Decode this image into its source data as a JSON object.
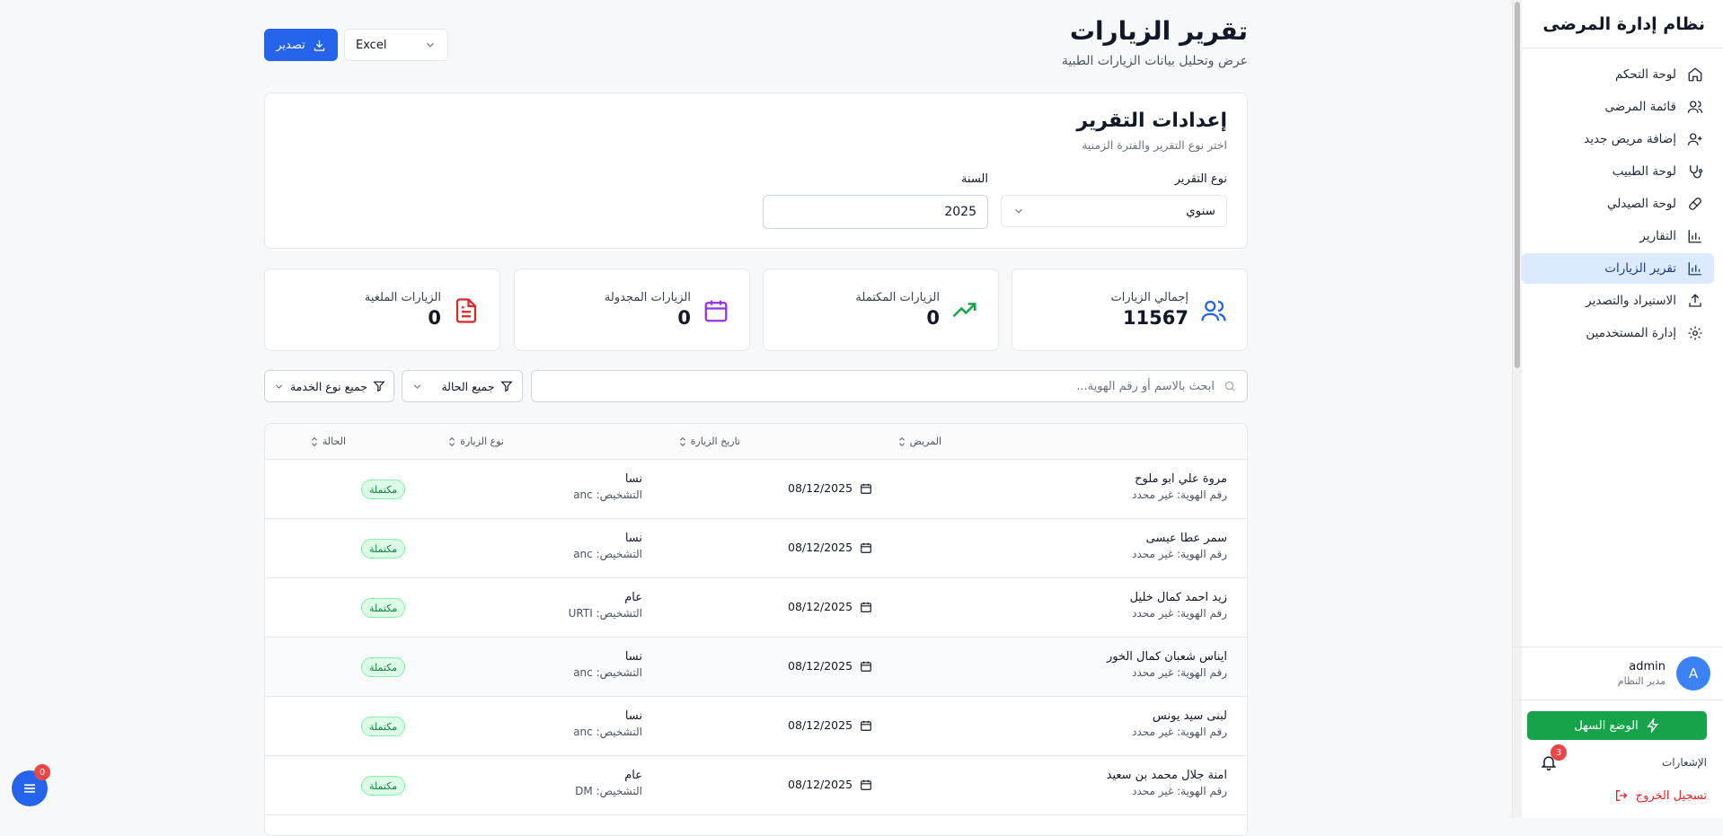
{
  "sidebar": {
    "title": "نظام إدارة المرضى",
    "items": [
      {
        "label": "لوحة التحكم",
        "icon": "home-icon"
      },
      {
        "label": "قائمة المرضى",
        "icon": "users-icon"
      },
      {
        "label": "إضافة مريض جديد",
        "icon": "user-plus-icon"
      },
      {
        "label": "لوحة الطبيب",
        "icon": "stethoscope-icon"
      },
      {
        "label": "لوحة الصيدلي",
        "icon": "pill-icon"
      },
      {
        "label": "التقارير",
        "icon": "bar-chart-icon"
      },
      {
        "label": "تقرير الزيارات",
        "icon": "bar-chart-icon",
        "active": true
      },
      {
        "label": "الاستيراد والتصدير",
        "icon": "upload-icon"
      },
      {
        "label": "إدارة المستخدمين",
        "icon": "gear-icon"
      }
    ],
    "user": {
      "initial": "A",
      "name": "admin",
      "role": "مدير النظام"
    },
    "easy_mode": "الوضع السهل",
    "notifications_label": "الإشعارات",
    "notifications_count": "3",
    "logout": "تسجيل الخروج"
  },
  "header": {
    "title": "تقرير الزيارات",
    "subtitle": "عرض وتحليل بيانات الزيارات الطبية",
    "export_label": "تصدير",
    "format_value": "Excel"
  },
  "settings": {
    "title": "إعدادات التقرير",
    "subtitle": "اختر نوع التقرير والفترة الزمنية",
    "type_label": "نوع التقرير",
    "type_value": "سنوي",
    "year_label": "السنة",
    "year_value": "2025"
  },
  "stats": [
    {
      "label": "إجمالي الزيارات",
      "value": "11567",
      "icon": "users-icon",
      "color": "#2563eb"
    },
    {
      "label": "الزيارات المكتملة",
      "value": "0",
      "icon": "trending-up-icon",
      "color": "#16a34a"
    },
    {
      "label": "الزيارات المجدولة",
      "value": "0",
      "icon": "calendar-icon",
      "color": "#9333ea"
    },
    {
      "label": "الزيارات الملغية",
      "value": "0",
      "icon": "file-text-icon",
      "color": "#dc2626"
    }
  ],
  "filters": {
    "search_placeholder": "ابحث بالاسم أو رقم الهوية...",
    "status_filter": "جميع الحالة",
    "service_filter": "جميع نوع الخدمة"
  },
  "table": {
    "columns": {
      "patient": "المريض",
      "date": "تاريخ الزيارة",
      "type": "نوع الزيارة",
      "status": "الحالة"
    },
    "rows": [
      {
        "name": "مروة علي ابو ملوح",
        "id_text": "رقم الهوية: غير محدد",
        "date": "08/12/2025",
        "type": "نسا",
        "diagnosis": "التشخيص: anc",
        "status": "مكتملة"
      },
      {
        "name": "سمر عطا عيسى",
        "id_text": "رقم الهوية: غير محدد",
        "date": "08/12/2025",
        "type": "نسا",
        "diagnosis": "التشخيص: anc",
        "status": "مكتملة"
      },
      {
        "name": "زيد احمد كمال خليل",
        "id_text": "رقم الهوية: غير محدد",
        "date": "08/12/2025",
        "type": "عام",
        "diagnosis": "التشخيص: URTI",
        "status": "مكتملة"
      },
      {
        "name": "ايناس شعبان كمال الخور",
        "id_text": "رقم الهوية: غير محدد",
        "date": "08/12/2025",
        "type": "نسا",
        "diagnosis": "التشخيص: anc",
        "status": "مكتملة"
      },
      {
        "name": "لبنى سيد يونس",
        "id_text": "رقم الهوية: غير محدد",
        "date": "08/12/2025",
        "type": "نسا",
        "diagnosis": "التشخيص: anc",
        "status": "مكتملة"
      },
      {
        "name": "امنة جلال محمد بن سعيد",
        "id_text": "رقم الهوية: غير محدد",
        "date": "08/12/2025",
        "type": "عام",
        "diagnosis": "التشخيص: DM",
        "status": "مكتملة"
      }
    ]
  },
  "fab": {
    "badge": "0"
  }
}
